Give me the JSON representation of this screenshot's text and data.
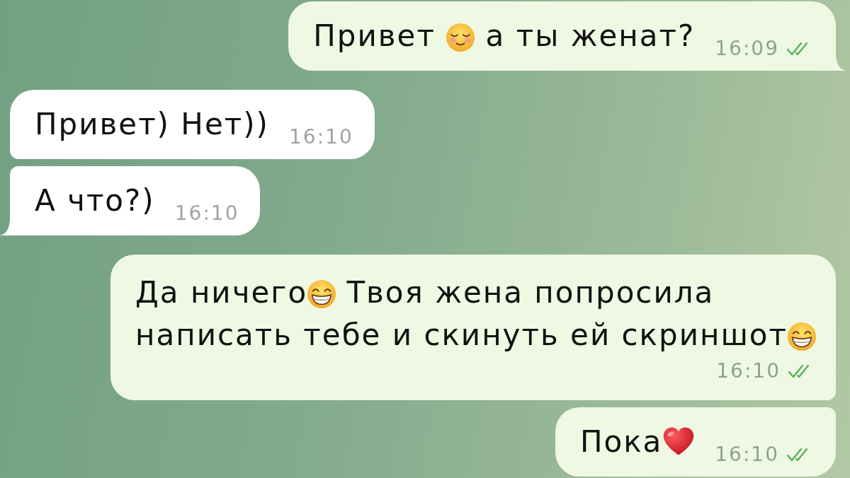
{
  "messages": [
    {
      "kind": "outgoing",
      "lines": [
        [
          {
            "kind": "text",
            "text": "Привет "
          },
          {
            "kind": "relieved"
          },
          {
            "kind": "text",
            "text": " а ты женат?"
          }
        ]
      ],
      "time": "16:09",
      "read": true,
      "tail": true
    },
    {
      "kind": "incoming",
      "lines": [
        [
          {
            "kind": "text",
            "text": "Привет) Нет))"
          }
        ]
      ],
      "time": "16:10",
      "tail": false
    },
    {
      "kind": "incoming",
      "lines": [
        [
          {
            "kind": "text",
            "text": "А что?)"
          }
        ]
      ],
      "time": "16:10",
      "tail": true
    },
    {
      "kind": "outgoing",
      "lines": [
        [
          {
            "kind": "text",
            "text": "Да ничего"
          },
          {
            "kind": "grin"
          },
          {
            "kind": "text",
            "text": " Твоя жена попросила"
          }
        ],
        [
          {
            "kind": "text",
            "text": "написать тебе и скинуть ей скриншот"
          },
          {
            "kind": "grin"
          }
        ]
      ],
      "time": "16:10",
      "read": true,
      "tail": false
    },
    {
      "kind": "outgoing",
      "lines": [
        [
          {
            "kind": "text",
            "text": "Пока"
          },
          {
            "kind": "heart"
          }
        ]
      ],
      "time": "16:10",
      "read": true,
      "tail": false
    }
  ]
}
